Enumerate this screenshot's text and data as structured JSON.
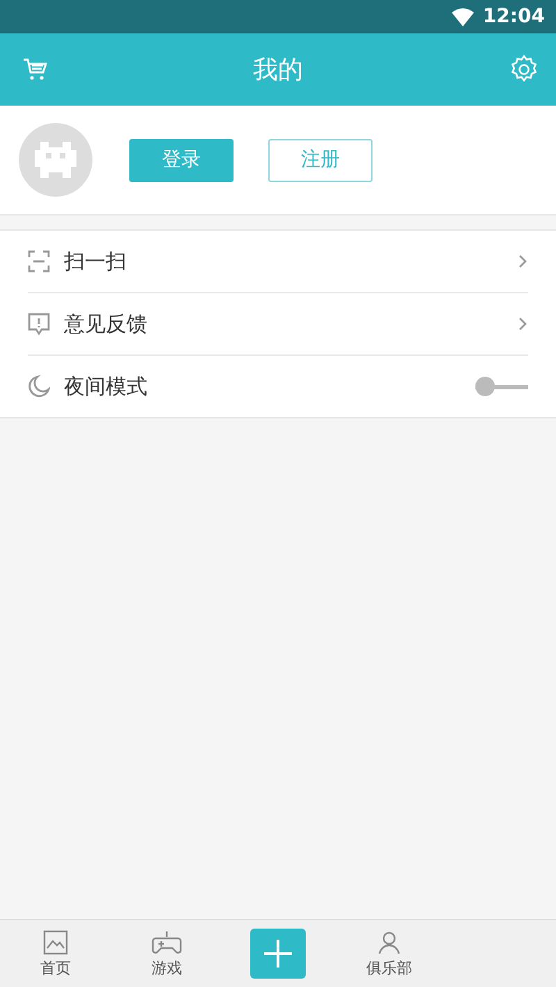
{
  "status_bar": {
    "time": "12:04"
  },
  "header": {
    "title": "我的"
  },
  "account": {
    "buttons": [
      {
        "label": "登录",
        "kind": "primary"
      },
      {
        "label": "注册",
        "kind": "outline"
      }
    ]
  },
  "menu": [
    {
      "label": "扫一扫",
      "kind": "scan"
    },
    {
      "label": "意见反馈",
      "kind": "feedback"
    },
    {
      "label": "夜间模式",
      "kind": "night",
      "on": false
    }
  ],
  "tab_bar": [
    {
      "label": "首页",
      "kind": "home"
    },
    {
      "label": "游戏",
      "kind": "games"
    },
    {
      "kind": "add"
    },
    {
      "label": "俱乐部",
      "kind": "club"
    }
  ]
}
